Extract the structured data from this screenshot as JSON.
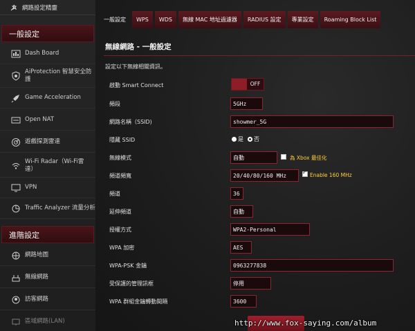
{
  "sidebar": {
    "top_label": "網路設定精靈",
    "section_general": "一般設定",
    "general_items": [
      {
        "label": "Dash Board",
        "icon": "dashboard-icon"
      },
      {
        "label": "AiProtection 智慧安全防\n護",
        "icon": "shield-icon"
      },
      {
        "label": "Game Acceleration",
        "icon": "rocket-icon"
      },
      {
        "label": "Open NAT",
        "icon": "nat-icon"
      },
      {
        "label": "遊戲探測雷達",
        "icon": "radar-icon"
      },
      {
        "label": "Wi-Fi Radar（Wi-Fi雷\n達）",
        "icon": "wifi-radar-icon"
      },
      {
        "label": "VPN",
        "icon": "vpn-icon"
      },
      {
        "label": "Traffic Analyzer 流量分析",
        "icon": "traffic-icon"
      }
    ],
    "section_advanced": "進階設定",
    "advanced_items": [
      {
        "label": "網路地圖",
        "icon": "network-map-icon"
      },
      {
        "label": "無線網路",
        "icon": "wireless-icon"
      },
      {
        "label": "訪客網路",
        "icon": "guest-network-icon"
      },
      {
        "label": "區域網路(LAN)",
        "icon": "lan-icon"
      }
    ]
  },
  "tabs": [
    {
      "label": "一般設定",
      "active": true
    },
    {
      "label": "WPS",
      "active": false
    },
    {
      "label": "WDS",
      "active": false
    },
    {
      "label": "無線 MAC 地址過濾器",
      "active": false
    },
    {
      "label": "RADIUS 設定",
      "active": false
    },
    {
      "label": "專業設定",
      "active": false
    },
    {
      "label": "Roaming Block List",
      "active": false
    }
  ],
  "page": {
    "title": "無線網路 - 一般設定",
    "description": "設定以下無線相關資訊。"
  },
  "fields": {
    "smart_connect": {
      "label": "啟動 Smart Connect",
      "state": "OFF"
    },
    "band": {
      "label": "頻段",
      "value": "5GHz"
    },
    "ssid": {
      "label": "網路名稱（SSID)",
      "value": "showmer_5G"
    },
    "hide_ssid": {
      "label": "隱藏 SSID",
      "yes": "是",
      "no": "否",
      "selected": "否"
    },
    "wireless_mode": {
      "label": "無線模式",
      "value": "自動",
      "xbox_label": "為 Xbox 最佳化",
      "xbox_checked": false
    },
    "bandwidth": {
      "label": "頻道頻寬",
      "value": "20/40/80/160 MHz",
      "enable160_label": "Enable 160 MHz",
      "enable160_checked": true
    },
    "channel": {
      "label": "頻道",
      "value": "36"
    },
    "ext_channel": {
      "label": "延伸頻道",
      "value": "自動"
    },
    "auth_method": {
      "label": "授權方式",
      "value": "WPA2-Personal"
    },
    "wpa_encryption": {
      "label": "WPA 加密",
      "value": "AES"
    },
    "wpa_psk": {
      "label": "WPA-PSK 金鑰",
      "value": "0963277838"
    },
    "pmf": {
      "label": "受保護的管理訊框",
      "value": "停用"
    },
    "group_key_interval": {
      "label": "WPA 群組金鑰轉動間隔",
      "value": "3600"
    }
  },
  "watermark": "http://www.fox-saying.com/album",
  "colors": {
    "accent": "#8b2530",
    "highlight": "#ffd23c"
  }
}
